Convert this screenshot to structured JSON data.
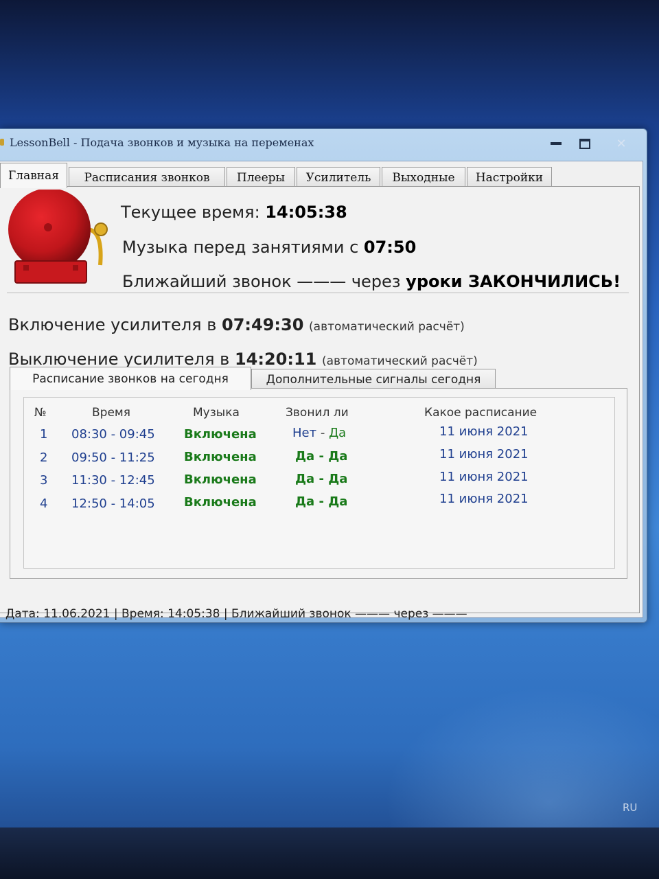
{
  "window": {
    "title": "LessonBell - Подача звонков и музыка на переменах",
    "close_glyph": "✕"
  },
  "tabs": [
    "Главная",
    "Расписания звонков",
    "Плееры",
    "Усилитель",
    "Выходные",
    "Настройки"
  ],
  "info": {
    "current_time_label": "Текущее время: ",
    "current_time": "14:05:38",
    "music_label": "Музыка перед занятиями с ",
    "music_time": "07:50",
    "next_bell_label": "Ближайший звонок ——— через ",
    "next_bell_value": "уроки ЗАКОНЧИЛИСЬ!"
  },
  "amplifier": {
    "on_label": "Включение усилителя в ",
    "on_time": "07:49:30",
    "on_note": "(автоматический расчёт)",
    "off_label": "Выключение усилителя в ",
    "off_time": "14:20:11",
    "off_note": "(автоматический расчёт)"
  },
  "subtabs": [
    "Расписание звонков на сегодня",
    "Дополнительные сигналы сегодня"
  ],
  "table": {
    "headers": [
      "№",
      "Время",
      "Музыка",
      "Звонил ли",
      "Какое расписание"
    ],
    "rows": [
      {
        "n": "1",
        "time": "08:30 - 09:45",
        "music": "Включена",
        "rang_a": "Нет",
        "rang_b": "Да",
        "schedule": "11 июня 2021"
      },
      {
        "n": "2",
        "time": "09:50 - 11:25",
        "music": "Включена",
        "rang_a": "Да",
        "rang_b": "Да",
        "schedule": "11 июня 2021"
      },
      {
        "n": "3",
        "time": "11:30 - 12:45",
        "music": "Включена",
        "rang_a": "Да",
        "rang_b": "Да",
        "schedule": "11 июня 2021"
      },
      {
        "n": "4",
        "time": "12:50 - 14:05",
        "music": "Включена",
        "rang_a": "Да",
        "rang_b": "Да",
        "schedule": "11 июня 2021"
      }
    ]
  },
  "statusbar": "Дата: 11.06.2021 | Время: 14:05:38 | Ближайший звонок ——— через ———",
  "taskbar": {
    "language": "RU"
  },
  "icons": {
    "bell": "alarm-bell-icon"
  },
  "colors": {
    "blue_text": "#1f3f8f",
    "green_text": "#1a7a1a",
    "bell_red": "#c0161b"
  }
}
